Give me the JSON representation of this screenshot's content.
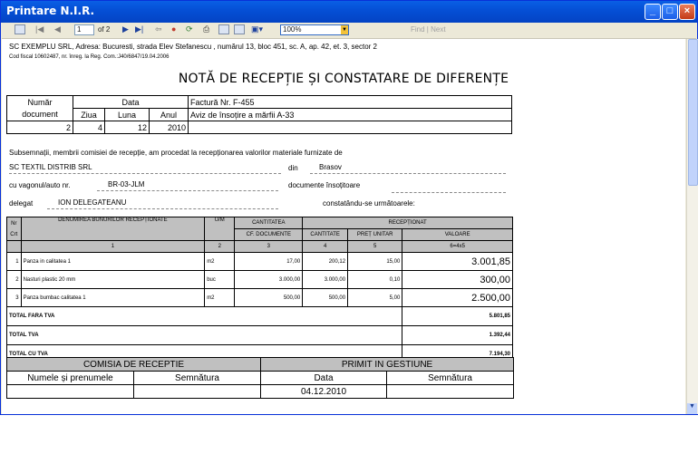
{
  "window": {
    "title": "Printare N.I.R."
  },
  "toolbar": {
    "page_current": "1",
    "page_of": "of 2",
    "zoom": "100%",
    "find": "Find",
    "next": "Next",
    "separator": "|"
  },
  "report": {
    "company_line": "SC EXEMPLU SRL, Adresa: Bucuresti, strada Elev Stefanescu , numărul 13, bloc 451, sc. A, ap. 42, et. 3, sector 2",
    "fiscal_line": "Cod fiscal 10602487, nr. înreg. la Reg. Com.:J40/6847/19.04.2006",
    "title": "NOTĂ DE RECEPȚIE ȘI CONSTATARE DE DIFERENȚE",
    "header_table": {
      "numar_label": "Număr",
      "document_label": "document",
      "data_label": "Data",
      "ziua_label": "Ziua",
      "luna_label": "Luna",
      "anul_label": "Anul",
      "factura": "Factură Nr. F-455",
      "aviz": "Aviz de însoțire a mărfii A-33",
      "numar": "2",
      "ziua": "4",
      "luna": "12",
      "anul": "2010"
    },
    "commission_text": "Subsemnații, membrii comisiei de recepție, am procedat la recepționarea valorilor materiale furnizate de",
    "supplier": "SC TEXTIL DISTRIB SRL",
    "din_label": "din",
    "city": "Brasov",
    "vehicle_label": "cu vagonul/auto nr.",
    "vehicle": "BR-03-JLM",
    "documents_label": "documente însoțitoare",
    "delegate_label": "delegat",
    "delegate": "ION DELEGATEANU",
    "constat_label": "constatându-se următoarele:",
    "items_table": {
      "nr_label": "Nr",
      "crt_label": "Crt",
      "den_label": "DENUMIREA BUNURILOR RECEPȚIONATE",
      "um_label": "U/M",
      "cant_label": "CANTITATEA",
      "cf_doc_label": "CF. DOCUMENTE",
      "receptionat_label": "RECEPȚIONAT",
      "cantitate_label": "CANTITATE",
      "pret_label": "PREȚ UNITAR",
      "valoare_label": "VALOARE",
      "col1": "1",
      "col2": "2",
      "col3": "3",
      "col4": "4",
      "col5": "5",
      "col6": "6=4x5",
      "rows": [
        {
          "nr": "1",
          "name": "Panza in calitatea 1",
          "um": "m2",
          "cf": "17,00",
          "qty": "200,12",
          "price": "15,00",
          "value": "3.001,85"
        },
        {
          "nr": "2",
          "name": "Nasturi plastic 20 mm",
          "um": "buc",
          "cf": "3.000,00",
          "qty": "3.000,00",
          "price": "0,10",
          "value": "300,00"
        },
        {
          "nr": "3",
          "name": "Panza bumbac calitatea 1",
          "um": "m2",
          "cf": "500,00",
          "qty": "500,00",
          "price": "5,00",
          "value": "2.500,00"
        }
      ],
      "total_fara_label": "TOTAL FARA TVA",
      "total_fara": "5.801,85",
      "total_tva_label": "TOTAL TVA",
      "total_tva": "1.392,44",
      "total_cu_label": "TOTAL CU TVA",
      "total_cu": "7.194,30"
    },
    "signatures": {
      "comisia_label": "COMISIA DE RECEPTIE",
      "primit_label": "PRIMIT IN GESTIUNE",
      "nume_label": "Numele și prenumele",
      "semnatura_label": "Semnătura",
      "data_label": "Data",
      "semnatura2_label": "Semnătura",
      "date": "04.12.2010"
    }
  }
}
